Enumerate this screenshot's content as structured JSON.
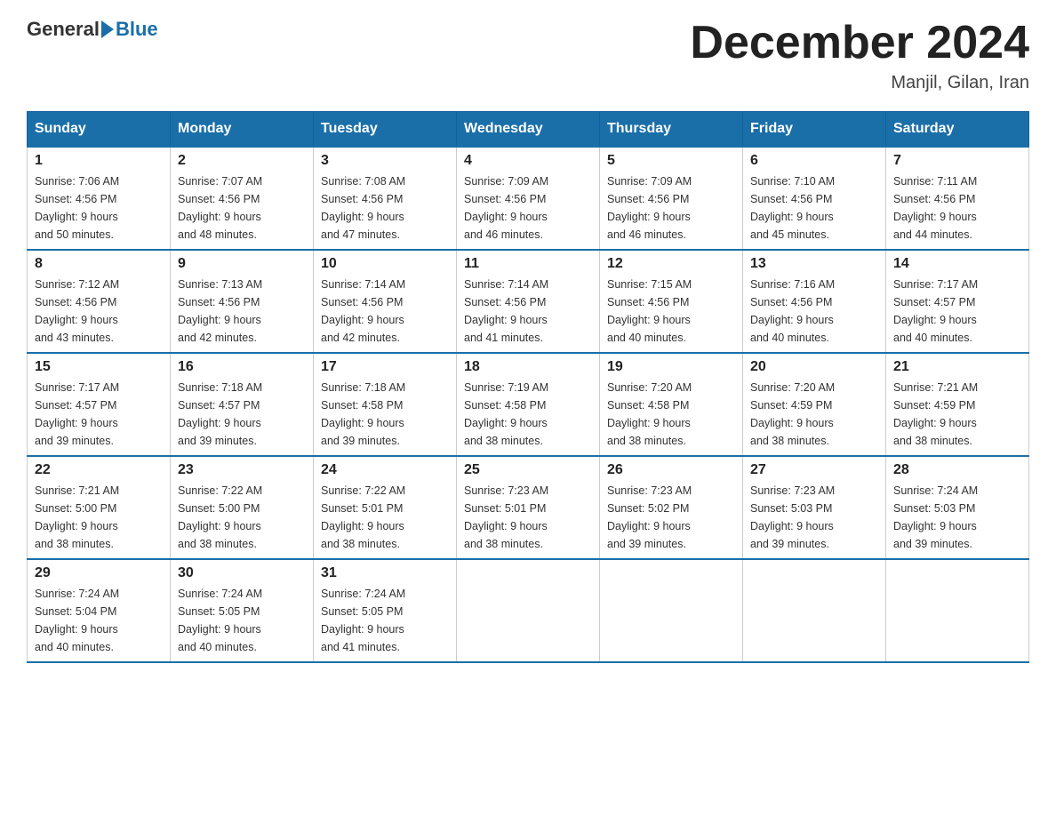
{
  "header": {
    "logo": {
      "general": "General",
      "blue": "Blue"
    },
    "title": "December 2024",
    "location": "Manjil, Gilan, Iran"
  },
  "weekdays": [
    "Sunday",
    "Monday",
    "Tuesday",
    "Wednesday",
    "Thursday",
    "Friday",
    "Saturday"
  ],
  "weeks": [
    [
      {
        "day": "1",
        "sunrise": "7:06 AM",
        "sunset": "4:56 PM",
        "daylight": "9 hours and 50 minutes."
      },
      {
        "day": "2",
        "sunrise": "7:07 AM",
        "sunset": "4:56 PM",
        "daylight": "9 hours and 48 minutes."
      },
      {
        "day": "3",
        "sunrise": "7:08 AM",
        "sunset": "4:56 PM",
        "daylight": "9 hours and 47 minutes."
      },
      {
        "day": "4",
        "sunrise": "7:09 AM",
        "sunset": "4:56 PM",
        "daylight": "9 hours and 46 minutes."
      },
      {
        "day": "5",
        "sunrise": "7:09 AM",
        "sunset": "4:56 PM",
        "daylight": "9 hours and 46 minutes."
      },
      {
        "day": "6",
        "sunrise": "7:10 AM",
        "sunset": "4:56 PM",
        "daylight": "9 hours and 45 minutes."
      },
      {
        "day": "7",
        "sunrise": "7:11 AM",
        "sunset": "4:56 PM",
        "daylight": "9 hours and 44 minutes."
      }
    ],
    [
      {
        "day": "8",
        "sunrise": "7:12 AM",
        "sunset": "4:56 PM",
        "daylight": "9 hours and 43 minutes."
      },
      {
        "day": "9",
        "sunrise": "7:13 AM",
        "sunset": "4:56 PM",
        "daylight": "9 hours and 42 minutes."
      },
      {
        "day": "10",
        "sunrise": "7:14 AM",
        "sunset": "4:56 PM",
        "daylight": "9 hours and 42 minutes."
      },
      {
        "day": "11",
        "sunrise": "7:14 AM",
        "sunset": "4:56 PM",
        "daylight": "9 hours and 41 minutes."
      },
      {
        "day": "12",
        "sunrise": "7:15 AM",
        "sunset": "4:56 PM",
        "daylight": "9 hours and 40 minutes."
      },
      {
        "day": "13",
        "sunrise": "7:16 AM",
        "sunset": "4:56 PM",
        "daylight": "9 hours and 40 minutes."
      },
      {
        "day": "14",
        "sunrise": "7:17 AM",
        "sunset": "4:57 PM",
        "daylight": "9 hours and 40 minutes."
      }
    ],
    [
      {
        "day": "15",
        "sunrise": "7:17 AM",
        "sunset": "4:57 PM",
        "daylight": "9 hours and 39 minutes."
      },
      {
        "day": "16",
        "sunrise": "7:18 AM",
        "sunset": "4:57 PM",
        "daylight": "9 hours and 39 minutes."
      },
      {
        "day": "17",
        "sunrise": "7:18 AM",
        "sunset": "4:58 PM",
        "daylight": "9 hours and 39 minutes."
      },
      {
        "day": "18",
        "sunrise": "7:19 AM",
        "sunset": "4:58 PM",
        "daylight": "9 hours and 38 minutes."
      },
      {
        "day": "19",
        "sunrise": "7:20 AM",
        "sunset": "4:58 PM",
        "daylight": "9 hours and 38 minutes."
      },
      {
        "day": "20",
        "sunrise": "7:20 AM",
        "sunset": "4:59 PM",
        "daylight": "9 hours and 38 minutes."
      },
      {
        "day": "21",
        "sunrise": "7:21 AM",
        "sunset": "4:59 PM",
        "daylight": "9 hours and 38 minutes."
      }
    ],
    [
      {
        "day": "22",
        "sunrise": "7:21 AM",
        "sunset": "5:00 PM",
        "daylight": "9 hours and 38 minutes."
      },
      {
        "day": "23",
        "sunrise": "7:22 AM",
        "sunset": "5:00 PM",
        "daylight": "9 hours and 38 minutes."
      },
      {
        "day": "24",
        "sunrise": "7:22 AM",
        "sunset": "5:01 PM",
        "daylight": "9 hours and 38 minutes."
      },
      {
        "day": "25",
        "sunrise": "7:23 AM",
        "sunset": "5:01 PM",
        "daylight": "9 hours and 38 minutes."
      },
      {
        "day": "26",
        "sunrise": "7:23 AM",
        "sunset": "5:02 PM",
        "daylight": "9 hours and 39 minutes."
      },
      {
        "day": "27",
        "sunrise": "7:23 AM",
        "sunset": "5:03 PM",
        "daylight": "9 hours and 39 minutes."
      },
      {
        "day": "28",
        "sunrise": "7:24 AM",
        "sunset": "5:03 PM",
        "daylight": "9 hours and 39 minutes."
      }
    ],
    [
      {
        "day": "29",
        "sunrise": "7:24 AM",
        "sunset": "5:04 PM",
        "daylight": "9 hours and 40 minutes."
      },
      {
        "day": "30",
        "sunrise": "7:24 AM",
        "sunset": "5:05 PM",
        "daylight": "9 hours and 40 minutes."
      },
      {
        "day": "31",
        "sunrise": "7:24 AM",
        "sunset": "5:05 PM",
        "daylight": "9 hours and 41 minutes."
      },
      null,
      null,
      null,
      null
    ]
  ],
  "labels": {
    "sunrise": "Sunrise:",
    "sunset": "Sunset:",
    "daylight": "Daylight:"
  }
}
